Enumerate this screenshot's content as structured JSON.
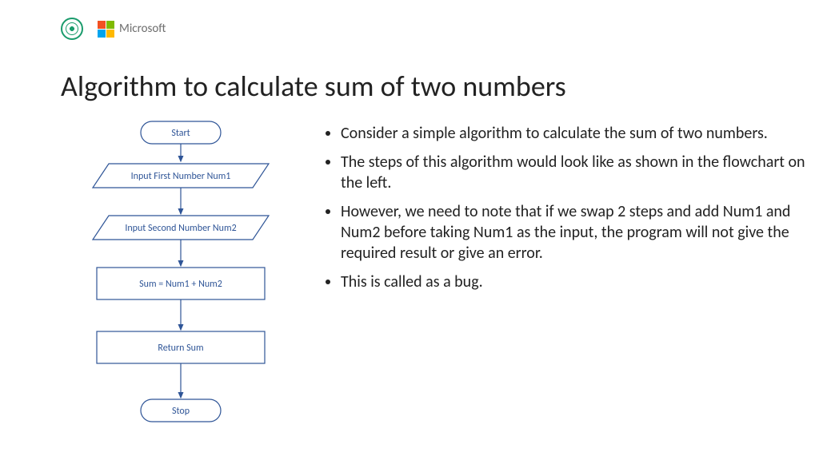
{
  "header": {
    "brand_text": "Microsoft"
  },
  "title": "Algorithm to calculate sum of two numbers",
  "flowchart": {
    "nodes": {
      "start": "Start",
      "input1": "Input First Number Num1",
      "input2": "Input Second Number Num2",
      "process": "Sum = Num1 + Num2",
      "return": "Return Sum",
      "stop": "Stop"
    }
  },
  "bullets": [
    "Consider a simple algorithm to calculate the sum of two numbers.",
    "The steps of this algorithm would look like as shown in the flowchart on the left.",
    "However, we need to note that if we swap 2 steps and add Num1 and Num2 before taking Num1 as the input, the program will not give the required result or give an error.",
    "This is called as a bug."
  ],
  "chart_data": {
    "type": "flowchart",
    "nodes": [
      {
        "id": "start",
        "shape": "terminator",
        "label": "Start"
      },
      {
        "id": "input1",
        "shape": "parallelogram",
        "label": "Input First Number Num1"
      },
      {
        "id": "input2",
        "shape": "parallelogram",
        "label": "Input Second Number Num2"
      },
      {
        "id": "process",
        "shape": "rectangle",
        "label": "Sum = Num1 + Num2"
      },
      {
        "id": "return",
        "shape": "rectangle",
        "label": "Return Sum"
      },
      {
        "id": "stop",
        "shape": "terminator",
        "label": "Stop"
      }
    ],
    "edges": [
      [
        "start",
        "input1"
      ],
      [
        "input1",
        "input2"
      ],
      [
        "input2",
        "process"
      ],
      [
        "process",
        "return"
      ],
      [
        "return",
        "stop"
      ]
    ],
    "stroke_color": "#2f5597",
    "text_color": "#2f5597"
  }
}
